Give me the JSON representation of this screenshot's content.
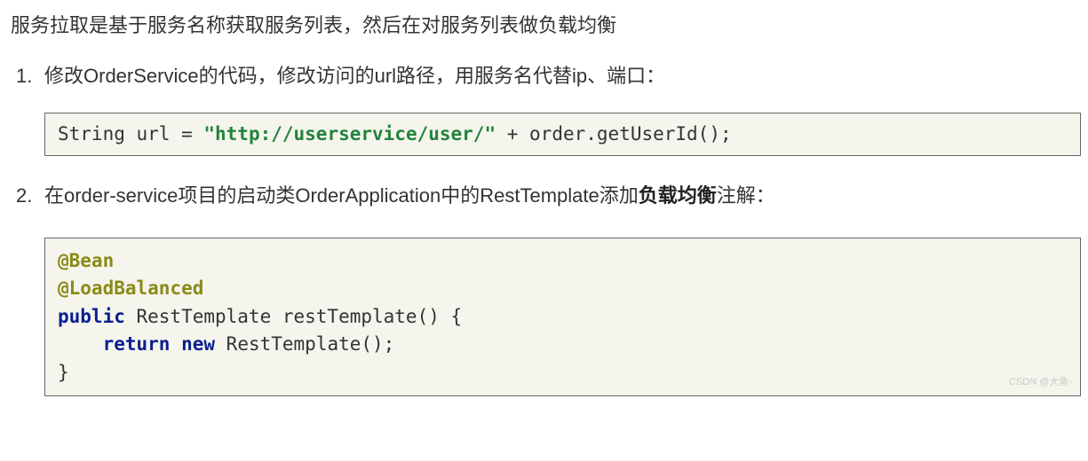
{
  "intro": "服务拉取是基于服务名称获取服务列表，然后在对服务列表做负载均衡",
  "steps": [
    {
      "num": "1.",
      "text": "修改OrderService的代码，修改访问的url路径，用服务名代替ip、端口：",
      "code": {
        "plain1": "String url = ",
        "string1": "\"http://userservice/user/\"",
        "plain2": " + order.getUserId();"
      }
    },
    {
      "num": "2.",
      "text_pre": "在order-service项目的启动类OrderApplication中的RestTemplate添加",
      "text_bold": "负载均衡",
      "text_post": "注解：",
      "code2": {
        "anno1": "@Bean",
        "anno2": "@LoadBalanced",
        "kw_public": "public",
        "plain_sig": " RestTemplate restTemplate() {",
        "indent": "    ",
        "kw_return": "return",
        "sp": " ",
        "kw_new": "new",
        "plain_call": " RestTemplate();",
        "close": "}"
      }
    }
  ],
  "watermark": "CSDN @大鱼-"
}
